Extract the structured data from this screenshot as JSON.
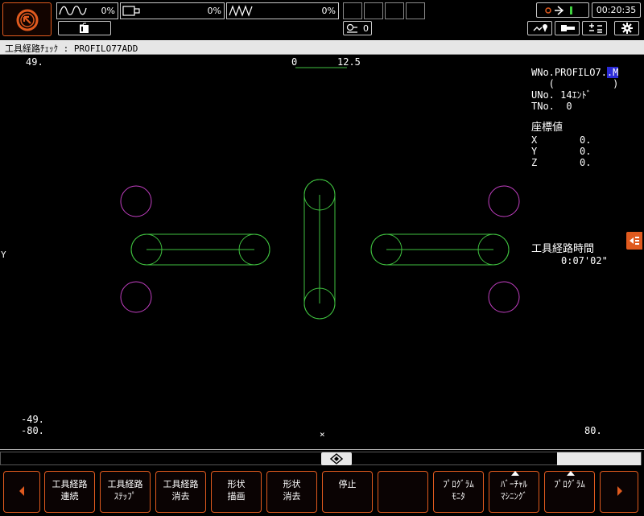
{
  "topbar": {
    "gauges": [
      {
        "icon": "spindle-wave-icon",
        "value": "0%"
      },
      {
        "icon": "axis-load-icon",
        "value": "0%"
      },
      {
        "icon": "feed-wave-icon",
        "value": "0%"
      }
    ],
    "tool_number": "0",
    "clock": "00:20:35"
  },
  "title": "工具経路ﾁｪｯｸ : PROFILO77ADD",
  "graphic": {
    "y_max_label": "49.",
    "y_min_label": "-49.",
    "x_min_label": "-80.",
    "x_max_label": "80.",
    "scale_left": "0",
    "scale_right": "12.5",
    "y_axis_label": "Y",
    "origin_marker": "×",
    "colors": {
      "path": "#3fbf3f",
      "circle": "#c23fc2"
    }
  },
  "info": {
    "wno_prefix": "WNo.PROFILO7.",
    "wno_highlight": ".M",
    "paren_line": "   (          )",
    "uno": "UNo. 14ｴﾝﾄﾞ",
    "tno": "TNo.  0",
    "coord_title": "座標値",
    "coords": [
      {
        "axis": "X",
        "value": "0."
      },
      {
        "axis": "Y",
        "value": "0."
      },
      {
        "axis": "Z",
        "value": "0."
      }
    ],
    "path_time_label": "工具経路時間",
    "path_time_value": "0:07'02\""
  },
  "softkeys": [
    {
      "line1": "工具経路",
      "line2": "連続"
    },
    {
      "line1": "工具経路",
      "line2": "ｽﾃｯﾌﾟ"
    },
    {
      "line1": "工具経路",
      "line2": "消去"
    },
    {
      "line1": "形状",
      "line2": "描画"
    },
    {
      "line1": "形状",
      "line2": "消去"
    },
    {
      "line1": "停止",
      "line2": ""
    },
    {
      "line1": "",
      "line2": ""
    },
    {
      "line1": "ﾌﾟﾛｸﾞﾗﾑ",
      "line2": "ﾓﾆﾀ"
    },
    {
      "line1": "ﾊﾞｰﾁｬﾙ",
      "line2": "ﾏｼﾆﾝｸﾞ"
    },
    {
      "line1": "ﾌﾟﾛｸﾞﾗﾑ",
      "line2": ""
    }
  ]
}
